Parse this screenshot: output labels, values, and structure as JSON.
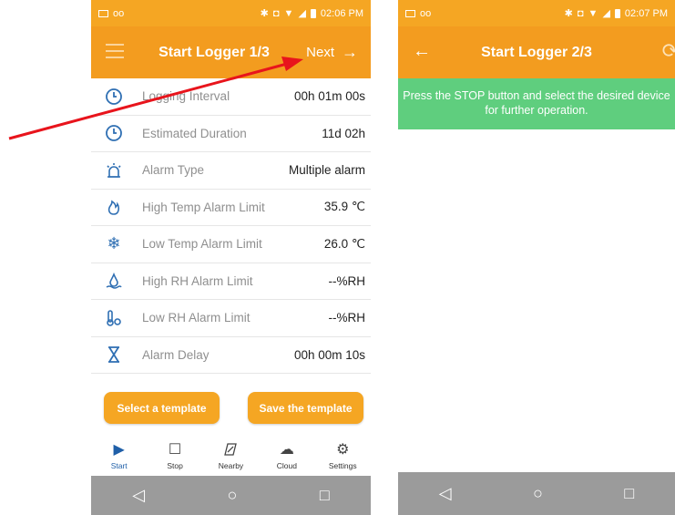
{
  "screen1": {
    "status": {
      "left": "oo",
      "time": "02:06 PM"
    },
    "title": "Start Logger 1/3",
    "next_label": "Next",
    "rows": [
      {
        "icon": "clock-icon",
        "label": "Logging Interval",
        "value": "00h 01m 00s"
      },
      {
        "icon": "clock-icon",
        "label": "Estimated Duration",
        "value": "11d 02h"
      },
      {
        "icon": "alarm-light-icon",
        "label": "Alarm Type",
        "value": "Multiple alarm"
      },
      {
        "icon": "flame-icon",
        "label": "High Temp Alarm Limit",
        "value": "35.9 ℃"
      },
      {
        "icon": "snowflake-icon",
        "label": "Low Temp Alarm Limit",
        "value": "26.0 ℃"
      },
      {
        "icon": "humidity-high-icon",
        "label": "High RH Alarm Limit",
        "value": "--%RH"
      },
      {
        "icon": "humidity-low-icon",
        "label": "Low RH Alarm Limit",
        "value": "--%RH"
      },
      {
        "icon": "hourglass-icon",
        "label": "Alarm Delay",
        "value": "00h 00m 10s"
      }
    ],
    "select_template": "Select a template",
    "save_template": "Save the template",
    "nav": [
      {
        "icon": "play-icon",
        "label": "Start"
      },
      {
        "icon": "stop-icon",
        "label": "Stop"
      },
      {
        "icon": "nearby-icon",
        "label": "Nearby"
      },
      {
        "icon": "cloud-icon",
        "label": "Cloud"
      },
      {
        "icon": "gear-icon",
        "label": "Settings"
      }
    ]
  },
  "screen2": {
    "status": {
      "left": "oo",
      "time": "02:07 PM"
    },
    "title": "Start Logger 2/3",
    "notice": "Press the STOP button and select the desired device for further operation."
  },
  "colors": {
    "accent": "#f39c1f",
    "notice": "#5fce7e",
    "arrow": "#e8141c",
    "nav_bar": "#9b9b9b"
  }
}
